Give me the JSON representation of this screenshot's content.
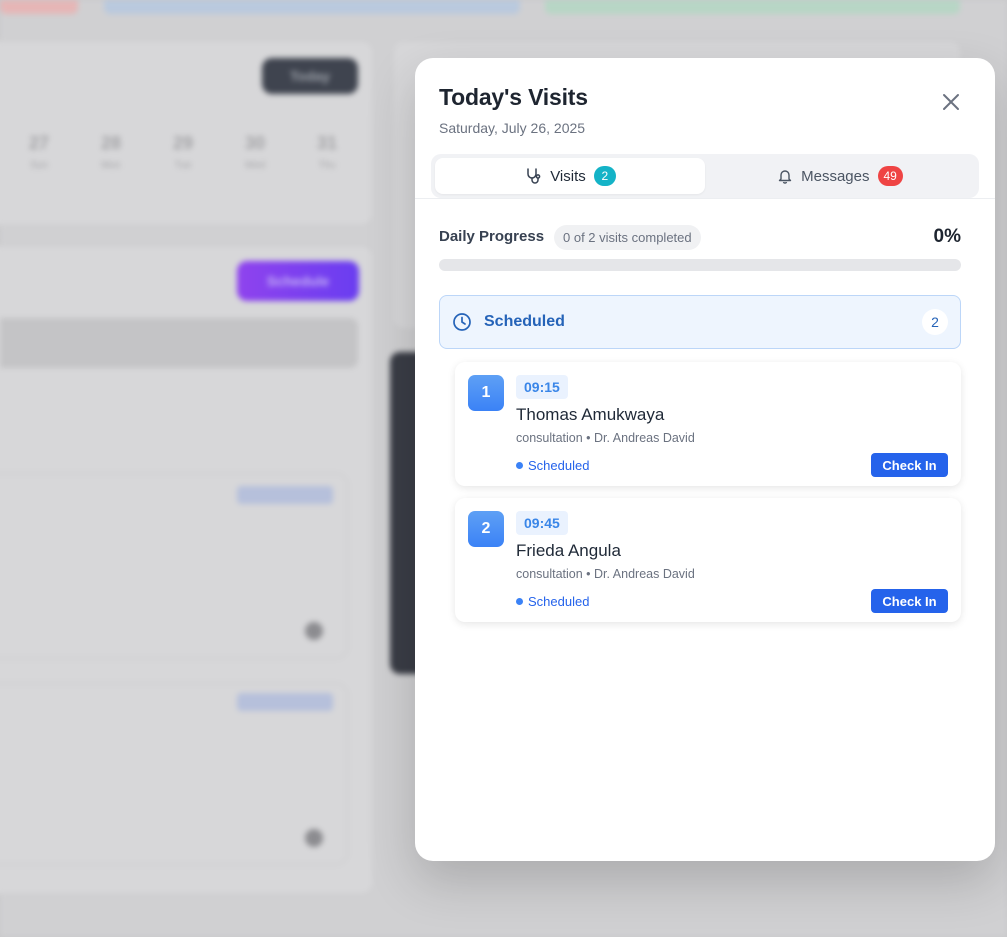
{
  "background": {
    "today_button": "Today",
    "schedule_button": "Schedule",
    "calendar_days": [
      {
        "num": "27",
        "label": "Sun"
      },
      {
        "num": "28",
        "label": "Mon"
      },
      {
        "num": "29",
        "label": "Tue"
      },
      {
        "num": "30",
        "label": "Wed"
      },
      {
        "num": "31",
        "label": "Thu"
      }
    ]
  },
  "modal": {
    "title": "Today's Visits",
    "date": "Saturday, July 26, 2025",
    "close_icon": "close-icon",
    "tabs": [
      {
        "label": "Visits",
        "count": "2",
        "icon": "stethoscope-icon",
        "active": true
      },
      {
        "label": "Messages",
        "count": "49",
        "icon": "bell-icon",
        "active": false
      }
    ],
    "progress": {
      "label": "Daily Progress",
      "summary": "0 of 2 visits completed",
      "percent_text": "0%",
      "fraction": 0
    },
    "section": {
      "title": "Scheduled",
      "count": "2",
      "icon": "clock-icon"
    },
    "visits": [
      {
        "number": "1",
        "time": "09:15",
        "patient": "Thomas Amukwaya",
        "details": "consultation • Dr. Andreas David",
        "status": "Scheduled",
        "action": "Check In"
      },
      {
        "number": "2",
        "time": "09:45",
        "patient": "Frieda Angula",
        "details": "consultation • Dr. Andreas David",
        "status": "Scheduled",
        "action": "Check In"
      }
    ]
  },
  "colors": {
    "accent": "#2563eb",
    "teal_badge": "#14b3c7",
    "red_badge": "#ef4444",
    "overlay": "#c9c9cb"
  }
}
